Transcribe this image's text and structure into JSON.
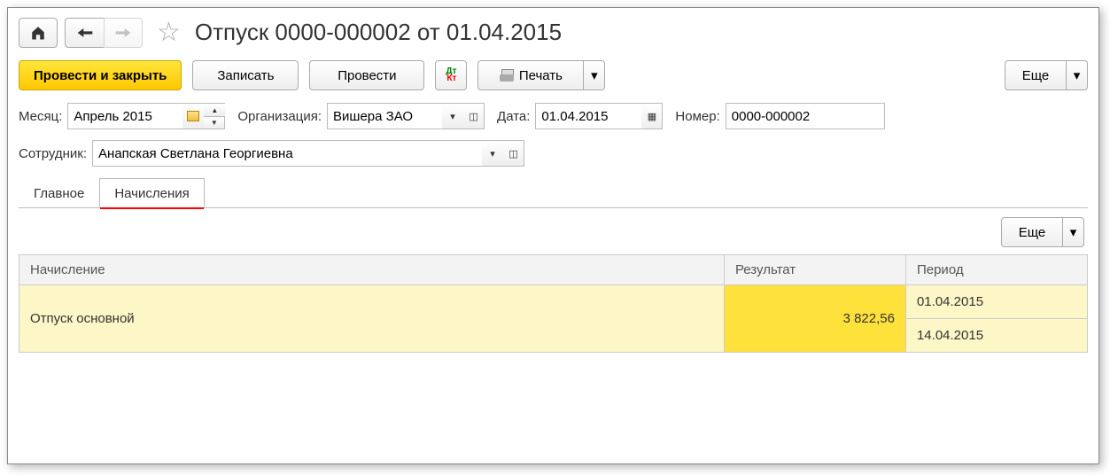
{
  "title": "Отпуск 0000-000002 от 01.04.2015",
  "toolbar": {
    "post_close": "Провести и закрыть",
    "save": "Записать",
    "post": "Провести",
    "print": "Печать",
    "more": "Еще"
  },
  "form": {
    "month_label": "Месяц:",
    "month_value": "Апрель 2015",
    "org_label": "Организация:",
    "org_value": "Вишера ЗАО",
    "date_label": "Дата:",
    "date_value": "01.04.2015",
    "number_label": "Номер:",
    "number_value": "0000-000002",
    "employee_label": "Сотрудник:",
    "employee_value": "Анапская Светлана Георгиевна"
  },
  "tabs": {
    "main": "Главное",
    "accruals": "Начисления"
  },
  "table": {
    "more": "Еще",
    "headers": {
      "accrual": "Начисление",
      "result": "Результат",
      "period": "Период"
    },
    "row1": {
      "name": "Отпуск основной",
      "result": "3 822,56",
      "period_from": "01.04.2015",
      "period_to": "14.04.2015"
    }
  }
}
